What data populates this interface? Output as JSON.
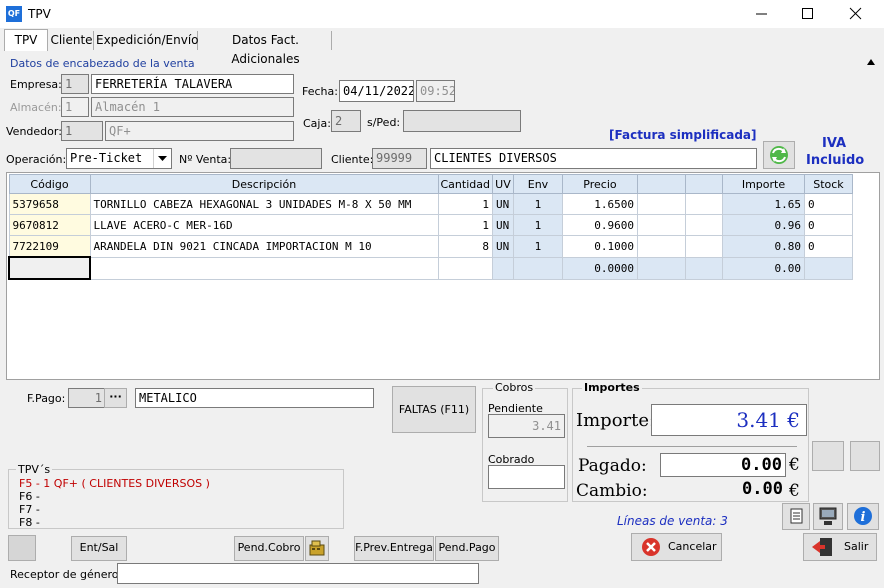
{
  "window": {
    "title": "TPV",
    "app_icon_label": "QF"
  },
  "tabs": [
    {
      "label": "TPV",
      "active": true
    },
    {
      "label": "Cliente",
      "active": false
    },
    {
      "label": "Expedición/Envío",
      "active": false
    },
    {
      "label": "Datos Fact. Adicionales",
      "active": false
    }
  ],
  "header": {
    "section_title": "Datos de encabezado de la venta",
    "empresa_label": "Empresa:",
    "empresa_code": "1",
    "empresa_name": "FERRETERÍA TALAVERA",
    "almacen_label": "Almacén:",
    "almacen_code": "1",
    "almacen_name": "Almacén 1",
    "vendedor_label": "Vendedor:",
    "vendedor_code": "1",
    "vendedor_name": "QF+",
    "fecha_label": "Fecha:",
    "fecha": "04/11/2022",
    "hora": "09:52",
    "caja_label": "Caja:",
    "caja": "2",
    "sped_label": "s/Ped:",
    "sped": "",
    "factura_label": "[Factura simplificada]",
    "iva_label_1": "IVA",
    "iva_label_2": "Incluido",
    "operacion_label": "Operación:",
    "operacion_value": "Pre-Ticket",
    "nventa_label": "Nº Venta:",
    "nventa": "",
    "cliente_label": "Cliente:",
    "cliente_code": "99999",
    "cliente_name": "CLIENTES DIVERSOS"
  },
  "table": {
    "columns": [
      "Código",
      "Descripción",
      "Cantidad",
      "UV",
      "Env",
      "Precio",
      "",
      "",
      "Importe",
      "Stock"
    ],
    "rows": [
      {
        "codigo": "5379658",
        "descripcion": "TORNILLO CABEZA HEXAGONAL 3 UNIDADES M-8 X 50 MM",
        "cantidad": "1",
        "uv": "UN",
        "env": "1",
        "precio": "1.6500",
        "importe": "1.65",
        "stock": "0"
      },
      {
        "codigo": "9670812",
        "descripcion": "LLAVE ACERO-C MER-16D",
        "cantidad": "1",
        "uv": "UN",
        "env": "1",
        "precio": "0.9600",
        "importe": "0.96",
        "stock": "0"
      },
      {
        "codigo": "7722109",
        "descripcion": "ARANDELA DIN 9021 CINCADA IMPORTACION M 10",
        "cantidad": "8",
        "uv": "UN",
        "env": "1",
        "precio": "0.1000",
        "importe": "0.80",
        "stock": "0"
      },
      {
        "codigo": "",
        "descripcion": "",
        "cantidad": "",
        "uv": "",
        "env": "",
        "precio": "0.0000",
        "importe": "0.00",
        "stock": ""
      }
    ]
  },
  "payment": {
    "fpago_label": "F.Pago:",
    "fpago_code": "1",
    "fpago_dots": "···",
    "fpago_name": "METALICO",
    "faltas_button": "FALTAS (F11)",
    "cobros_title": "Cobros",
    "pendiente_label": "Pendiente",
    "pendiente_value": "3.41",
    "cobrado_label": "Cobrado",
    "cobrado_value": "",
    "importes_title": "Importes",
    "importe_label": "Importe:",
    "importe_value": "3.41 €",
    "pagado_label": "Pagado:",
    "pagado_value": "0.00",
    "cambio_label": "Cambio:",
    "cambio_value": "0.00",
    "euro": "€",
    "lineas_label": "Líneas de venta: 3"
  },
  "tpvs": {
    "title": "TPV´s",
    "items": [
      "F5 - 1 QF+ ( CLIENTES DIVERSOS )",
      "F6 -",
      "F7 -",
      "F8 -"
    ]
  },
  "buttons": {
    "ent_sal": "Ent/Sal",
    "pend_cobro": "Pend.Cobro",
    "fprev_entrega": "F.Prev.Entrega",
    "pend_pago": "Pend.Pago",
    "cancelar": "Cancelar",
    "salir": "Salir"
  },
  "receptor": {
    "label": "Receptor de género",
    "value": ""
  },
  "colors": {
    "accent_blue": "#1c2fc0",
    "header_blue": "#1f3f9f",
    "tpv_red": "#c00000",
    "row_tint": "#dbe7f4",
    "code_yellow": "#fffbe0"
  }
}
